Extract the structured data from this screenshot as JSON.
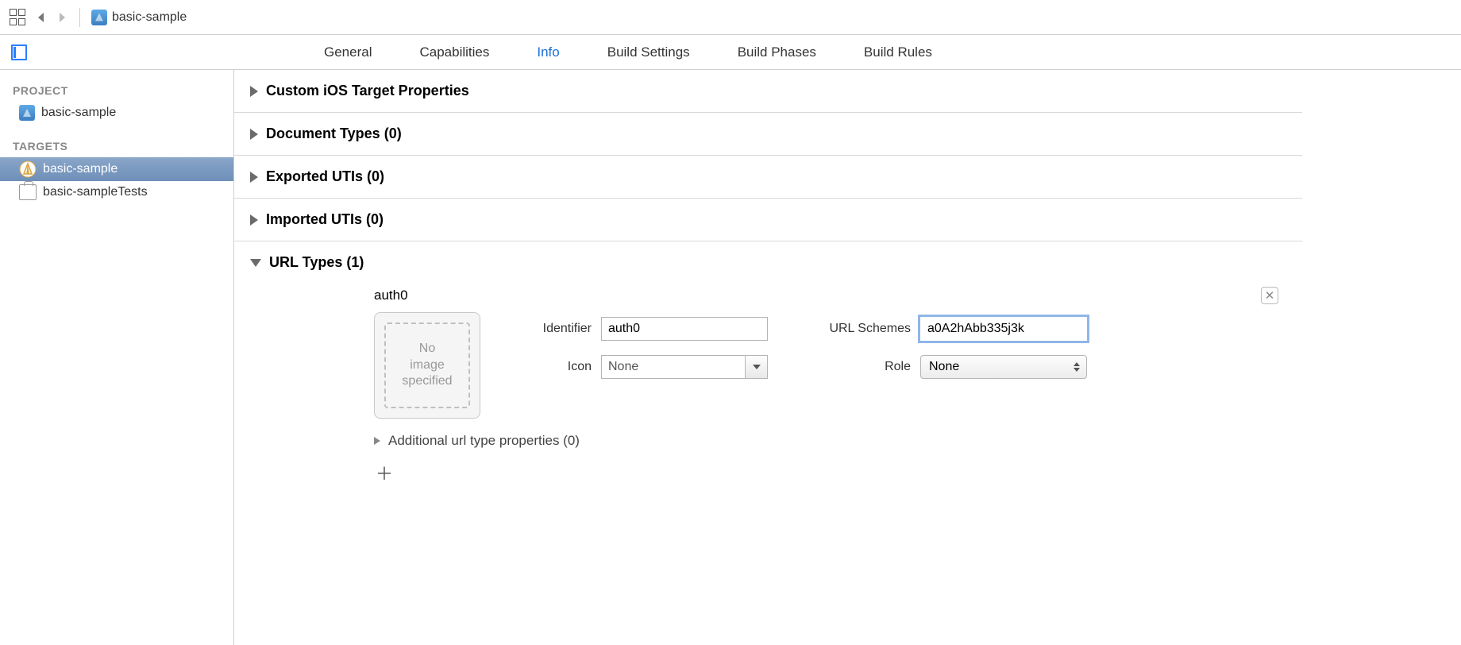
{
  "toolbar": {
    "project_name": "basic-sample"
  },
  "tabs": {
    "general": "General",
    "capabilities": "Capabilities",
    "info": "Info",
    "build_settings": "Build Settings",
    "build_phases": "Build Phases",
    "build_rules": "Build Rules"
  },
  "sidebar": {
    "project_header": "PROJECT",
    "project_name": "basic-sample",
    "targets_header": "TARGETS",
    "target_app": "basic-sample",
    "target_tests": "basic-sampleTests"
  },
  "sections": {
    "custom_props": "Custom iOS Target Properties",
    "doc_types": "Document Types (0)",
    "exported_utis": "Exported UTIs (0)",
    "imported_utis": "Imported UTIs (0)",
    "url_types": "URL Types (1)"
  },
  "url_type": {
    "name": "auth0",
    "identifier_label": "Identifier",
    "identifier_value": "auth0",
    "icon_label": "Icon",
    "icon_value": "None",
    "url_schemes_label": "URL Schemes",
    "url_schemes_value": "a0A2hAbb335j3k",
    "role_label": "Role",
    "role_value": "None",
    "image_well": "No\nimage\nspecified",
    "additional": "Additional url type properties (0)"
  }
}
